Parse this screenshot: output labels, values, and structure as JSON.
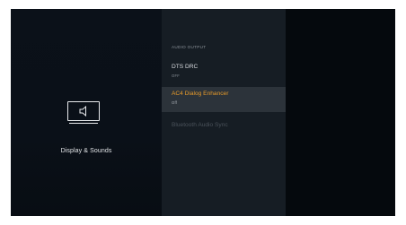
{
  "category": {
    "icon": "speaker-in-tv-icon",
    "label": "Display & Sounds"
  },
  "options_pane": {
    "section_header": "AUDIO OUTPUT",
    "items": [
      {
        "title": "DTS DRC",
        "value": "OFF",
        "state": "normal"
      },
      {
        "title": "AC4 Dialog Enhancer",
        "value": "Off",
        "state": "focused"
      },
      {
        "title": "Bluetooth Audio Sync",
        "state": "disabled"
      }
    ]
  },
  "colors": {
    "focus_accent": "#e69a2a",
    "focus_background": "#2c333a",
    "pane_background": "#161d24",
    "screen_background": "#070b10"
  }
}
